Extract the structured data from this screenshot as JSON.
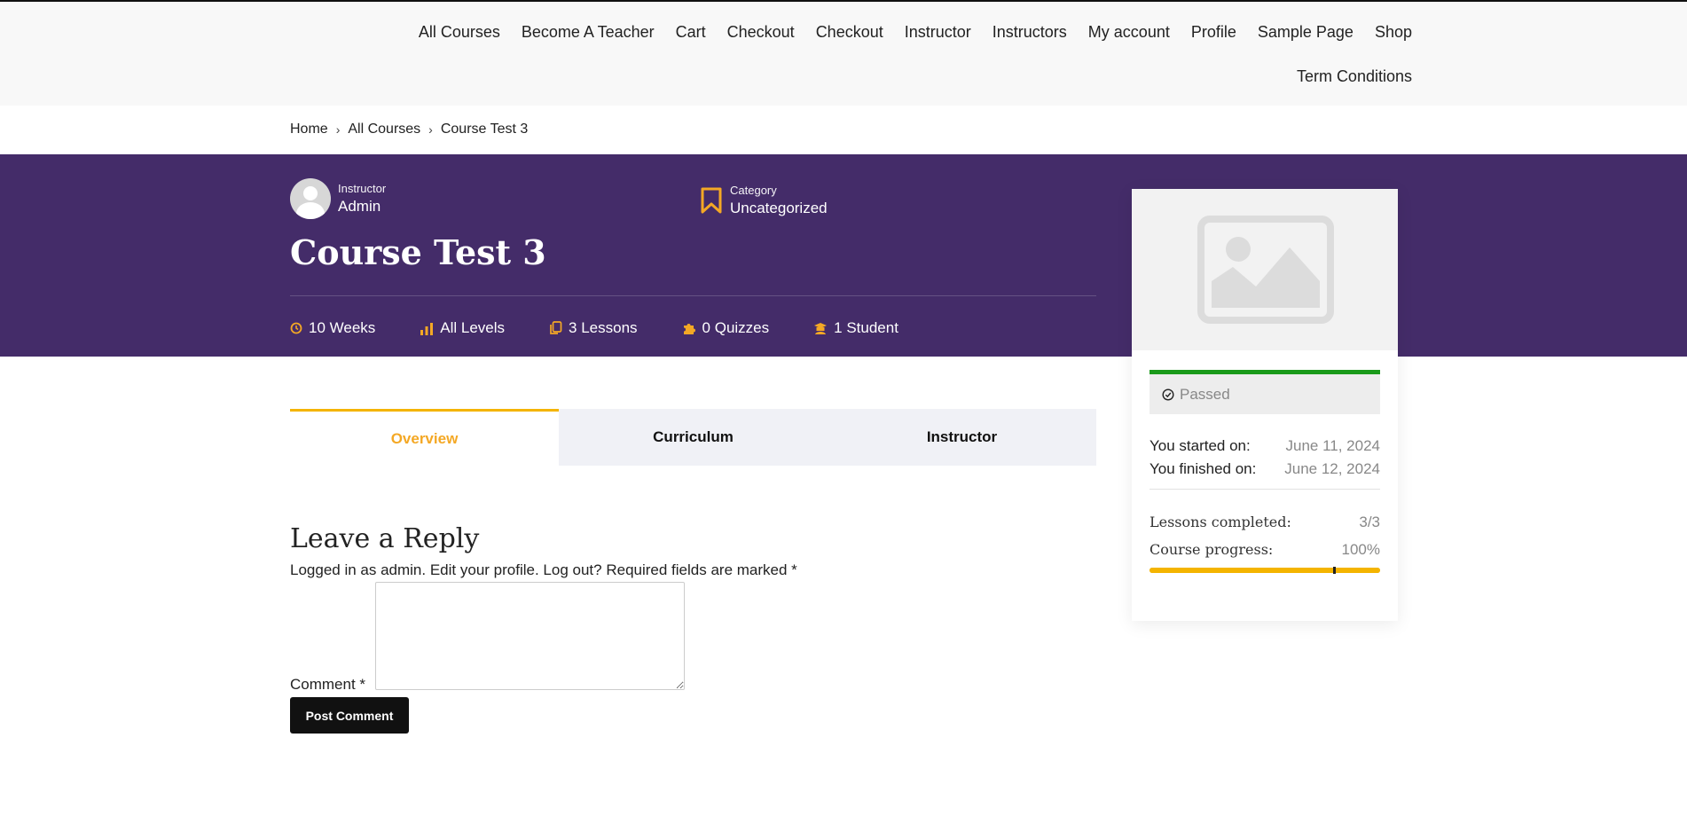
{
  "nav": {
    "row1": [
      "All Courses",
      "Become A Teacher",
      "Cart",
      "Checkout",
      "Checkout",
      "Instructor",
      "Instructors",
      "My account",
      "Profile",
      "Sample Page",
      "Shop"
    ],
    "row2": [
      "Term Conditions"
    ]
  },
  "breadcrumb": {
    "home": "Home",
    "courses": "All Courses",
    "current": "Course Test 3"
  },
  "hero": {
    "instructor_label": "Instructor",
    "instructor_name": "Admin",
    "category_label": "Category",
    "category_name": "Uncategorized",
    "title": "Course Test 3",
    "stats": {
      "duration": "10 Weeks",
      "level": "All Levels",
      "lessons": "3 Lessons",
      "quizzes": "0 Quizzes",
      "students": "1 Student"
    },
    "icon_color": "#f4a825",
    "background": "#442c69"
  },
  "sidebar": {
    "status": "Passed",
    "started_label": "You started on:",
    "started_value": "June 11, 2024",
    "finished_label": "You finished on:",
    "finished_value": "June 12, 2024",
    "lessons_label": "Lessons completed:",
    "lessons_value": "3/3",
    "progress_label": "Course progress:",
    "progress_value": "100%",
    "progress_fraction": 1.0
  },
  "tabs": [
    "Overview",
    "Curriculum",
    "Instructor"
  ],
  "reply": {
    "title": "Leave a Reply",
    "logged_prefix": "Logged in as admin. ",
    "edit_profile": "Edit your profile.",
    "log_out": "Log out?",
    "required": " Required fields are marked *",
    "comment_label": "Comment *",
    "post_button": "Post Comment"
  }
}
